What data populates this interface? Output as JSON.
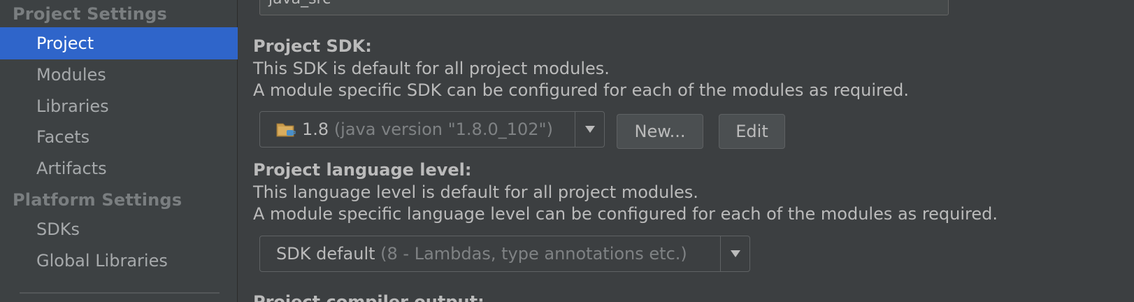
{
  "sidebar": {
    "sections": [
      {
        "header": "Project Settings",
        "items": [
          "Project",
          "Modules",
          "Libraries",
          "Facets",
          "Artifacts"
        ]
      },
      {
        "header": "Platform Settings",
        "items": [
          "SDKs",
          "Global Libraries"
        ]
      }
    ],
    "selected_item": "Project"
  },
  "main": {
    "top_field_value": "java_src",
    "sdk": {
      "label": "Project SDK:",
      "desc1": "This SDK is default for all project modules.",
      "desc2": "A module specific SDK can be configured for each of the modules as required.",
      "combo_value": "1.8",
      "combo_detail": "(java version \"1.8.0_102\")",
      "icon": "sdk-folder-icon",
      "new_button": "New...",
      "edit_button": "Edit"
    },
    "language_level": {
      "label": "Project language level:",
      "desc1": "This language level is default for all project modules.",
      "desc2": "A module specific language level can be configured for each of the modules as required.",
      "combo_value": "SDK default",
      "combo_detail": "(8 - Lambdas, type annotations etc.)"
    },
    "compiler_output_label": "Project compiler output:"
  },
  "colors": {
    "background": "#3c3f41",
    "sidebar_background": "#3d4143",
    "selection": "#2f65ca",
    "text": "#bbbbbb",
    "section_header": "#7a7e80",
    "muted": "#7f8284"
  }
}
